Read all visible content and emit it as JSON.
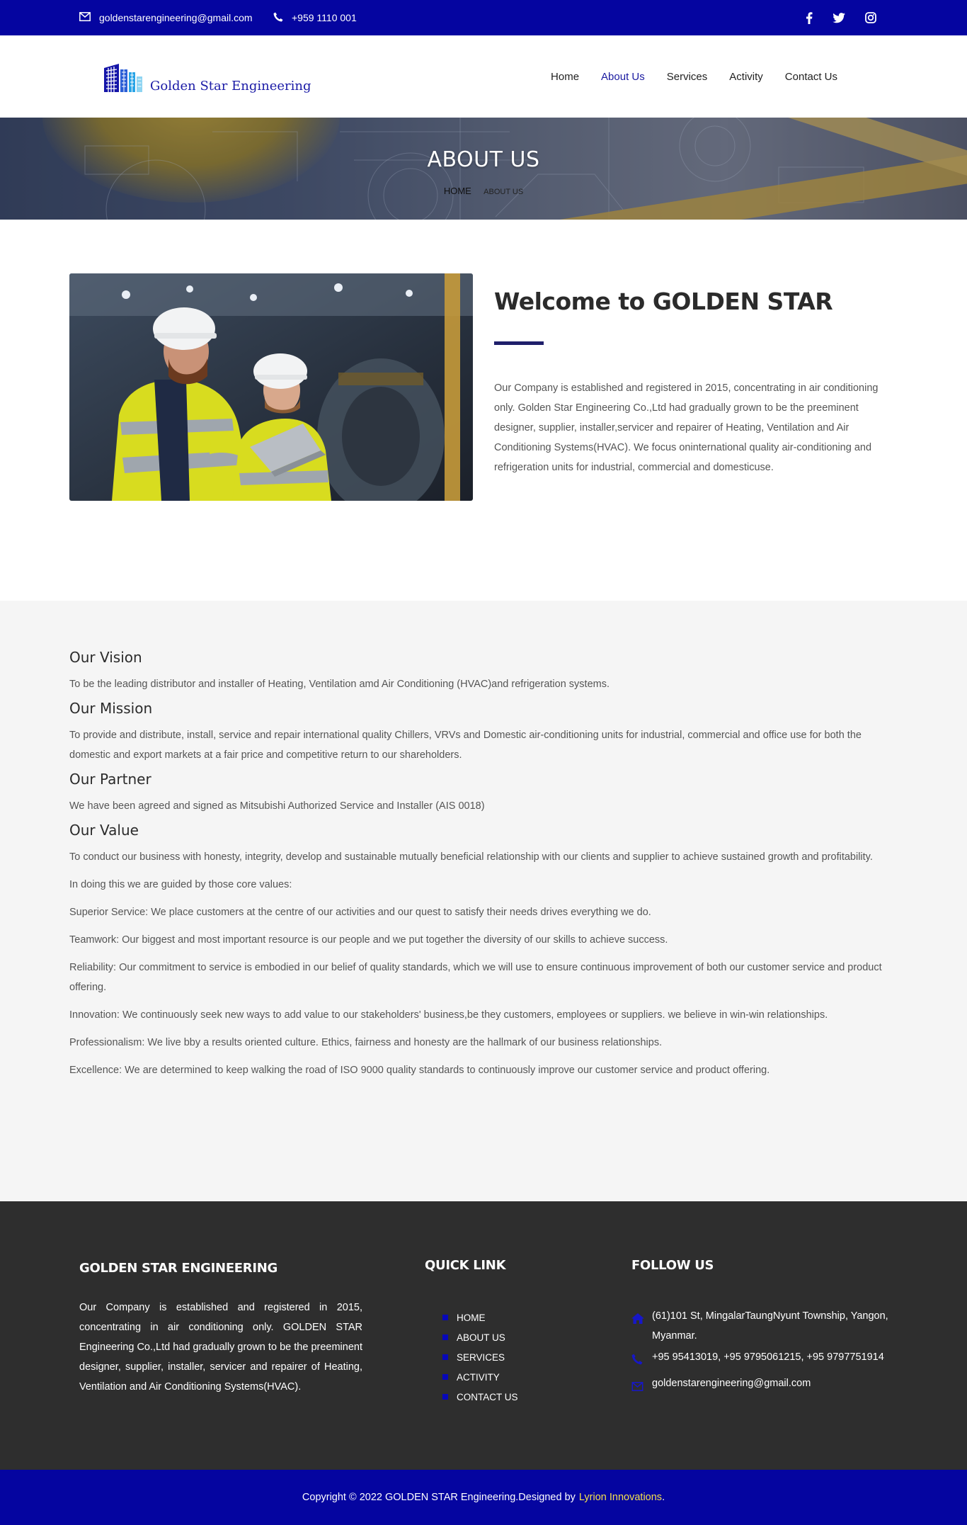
{
  "topbar": {
    "email": "goldenstarengineering@gmail.com",
    "phone": "+959 1110 001",
    "social": [
      "facebook-icon",
      "twitter-icon",
      "instagram-icon"
    ]
  },
  "header": {
    "logo_text": "Golden Star Engineering",
    "nav": [
      {
        "label": "Home"
      },
      {
        "label": "About Us",
        "active": true
      },
      {
        "label": "Services"
      },
      {
        "label": "Activity"
      },
      {
        "label": "Contact Us"
      }
    ]
  },
  "hero": {
    "title": "ABOUT US",
    "breadcrumb_home": "HOME",
    "breadcrumb_current": "ABOUT US"
  },
  "welcome": {
    "title": "Welcome to GOLDEN STAR",
    "text": "Our Company is established and registered in 2015, concentrating in air conditioning only. Golden Star Engineering Co.,Ltd had gradually grown to be the preeminent designer, supplier, installer,servicer and repairer of Heating, Ventilation and Air Conditioning Systems(HVAC). We focus oninternational quality air-conditioning and refrigeration units for industrial, commercial and domesticuse."
  },
  "values": {
    "vision_title": "Our Vision",
    "vision_text": "To be the leading distributor and installer of Heating, Ventilation amd Air Conditioning (HVAC)and refrigeration systems.",
    "mission_title": "Our Mission",
    "mission_text": "To provide and distribute, install, service and repair international quality Chillers, VRVs and Domestic air-conditioning units for industrial, commercial and office use for both the domestic and export markets at a fair price and competitive return to our shareholders.",
    "partner_title": "Our Partner",
    "partner_text": "We have been agreed and signed as Mitsubishi Authorized Service and Installer (AIS 0018)",
    "value_title": "Our Value",
    "value_items": [
      "To conduct our business with honesty, integrity, develop and sustainable mutually beneficial relationship with our clients and supplier to achieve sustained growth and profitability.",
      "In doing this we are guided by those core values:",
      "Superior Service: We place customers at the centre of our activities and our quest to satisfy their needs drives everything we do.",
      "Teamwork: Our biggest and most important resource is our people and we put together the diversity of our skills to achieve success.",
      "Reliability: Our commitment to service is embodied in our belief of quality standards, which we will use to ensure continuous improvement of both our customer service and product offering.",
      "Innovation: We continuously seek new ways to add value to our stakeholders' business,be they customers, employees or suppliers. we believe in win-win relationships.",
      "Professionalism: We live bby a results oriented culture. Ethics, fairness and honesty are the hallmark of our business relationships.",
      "Excellence: We are determined to keep walking the road of ISO 9000 quality standards to continuously improve our customer service and product offering."
    ]
  },
  "footer": {
    "about_title": "GOLDEN STAR ENGINEERING",
    "about_text": "Our Company is established and registered in 2015, concentrating in air conditioning only. GOLDEN STAR Engineering Co.,Ltd had gradually grown to be the preeminent designer, supplier, installer, servicer and repairer of Heating, Ventilation and Air Conditioning Systems(HVAC).",
    "quick_title": "QUICK LINK",
    "quick_links": [
      "HOME",
      "ABOUT US",
      "SERVICES",
      "ACTIVITY",
      "CONTACT US"
    ],
    "follow_title": "FOLLOW US",
    "address": "(61)101 St, MingalarTaungNyunt Township, Yangon, Myanmar.",
    "phones": "+95 95413019, +95 9795061215, +95 9797751914",
    "email": "goldenstarengineering@gmail.com"
  },
  "copyright": {
    "text": "Copyright © 2022 GOLDEN STAR Engineering.Designed by",
    "brand": "Lyrion Innovations",
    "suffix": "."
  },
  "colors": {
    "brand_blue": "#0505a0",
    "nav_active": "#1a1aa0",
    "footer_bg": "#2e2e2e",
    "accent_yellow": "#f4e04d"
  }
}
